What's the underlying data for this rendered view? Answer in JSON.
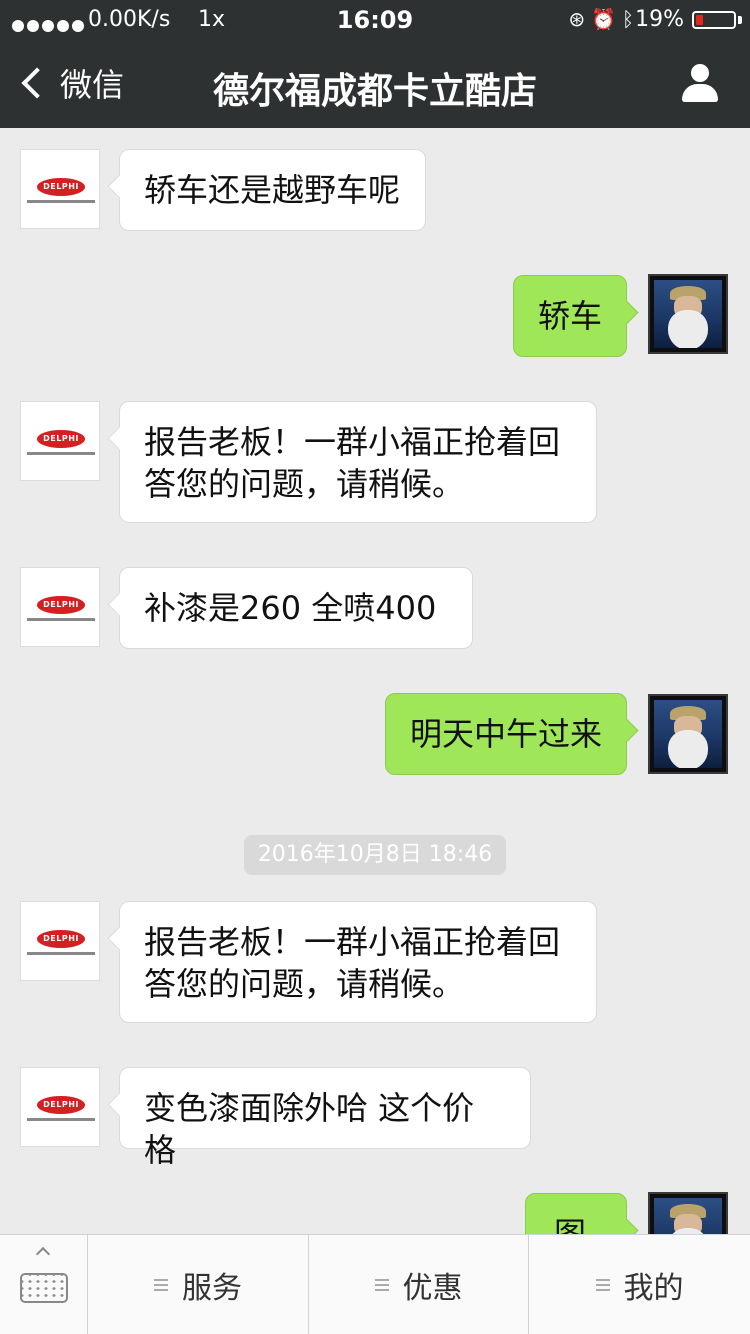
{
  "status_bar": {
    "network": "0.00K/s",
    "rate": "1x",
    "time": "16:09",
    "battery": "19%",
    "battery_level": 0.19,
    "icons": [
      "lock-rotation-icon",
      "alarm-icon",
      "bluetooth-icon"
    ]
  },
  "nav": {
    "back_label": "微信",
    "title": "德尔福成都卡立酷店"
  },
  "shop_avatar": {
    "logo_text": "DELPHI"
  },
  "messages": [
    {
      "side": "left",
      "text": "轿车还是越野车呢"
    },
    {
      "side": "right",
      "text": "轿车"
    },
    {
      "side": "left",
      "line1": "报告老板！一群小福正抢着回",
      "line2": "答您的问题，请稍候。"
    },
    {
      "side": "left",
      "text": "补漆是260   全喷400"
    },
    {
      "side": "right",
      "text": "明天中午过来"
    },
    {
      "side": "left",
      "line1": "报告老板！一群小福正抢着回",
      "line2": "答您的问题，请稍候。"
    },
    {
      "side": "left",
      "text": "变色漆面除外哈 这个价格"
    },
    {
      "side": "right",
      "text": "图"
    }
  ],
  "timestamp": "2016年10月8日 18:46",
  "bottom_menu": {
    "items": [
      "服务",
      "优惠",
      "我的"
    ]
  },
  "colors": {
    "nav_bg": "#2e3132",
    "chat_bg": "#ebebeb",
    "sent_bubble": "#9fe658",
    "received_bubble": "#ffffff",
    "battery_low": "#e0281c"
  }
}
